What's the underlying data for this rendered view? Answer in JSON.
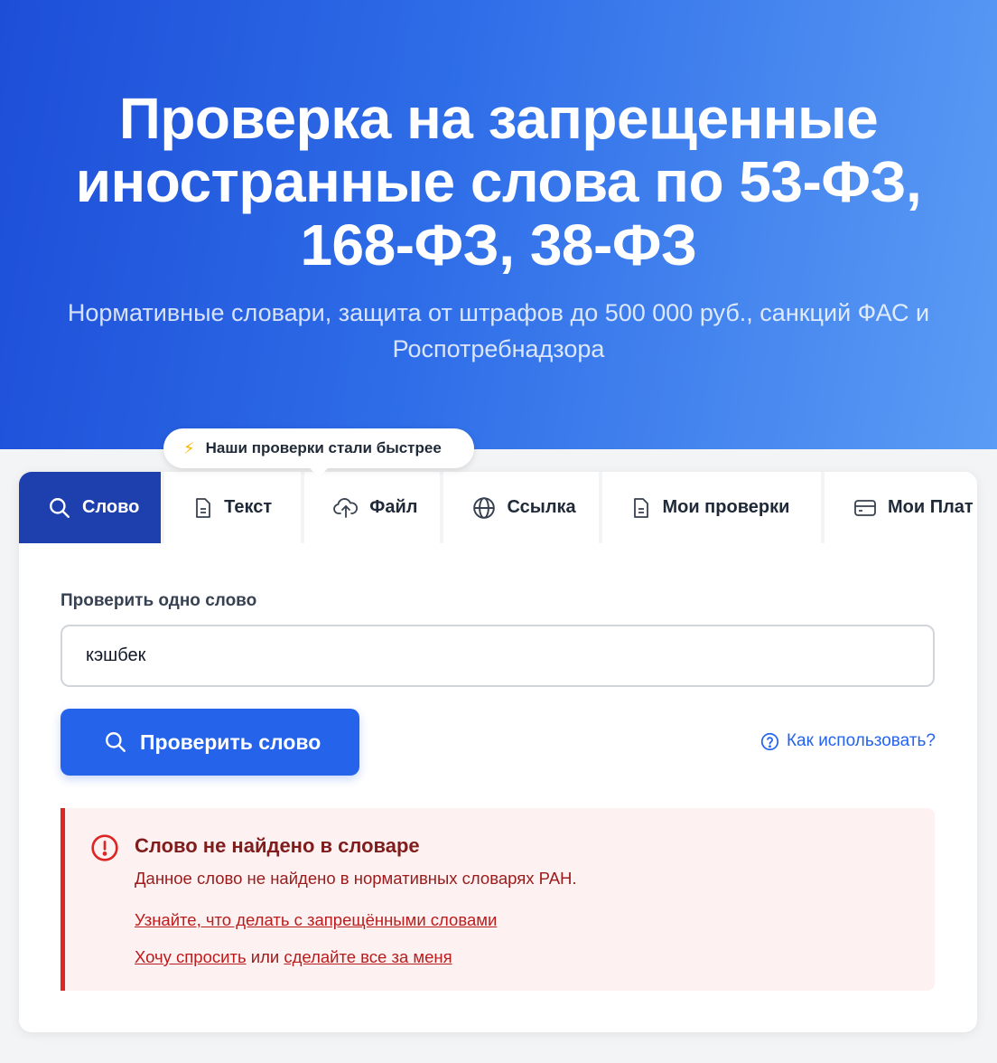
{
  "hero": {
    "title": "Проверка на запрещенные иностранные слова по 53-ФЗ, 168-ФЗ, 38-ФЗ",
    "subtitle": "Нормативные словари, защита от штрафов до 500 000 руб., санкций ФАС и Роспотребнадзора"
  },
  "tooltip": {
    "icon": "lightning-icon",
    "text": "Наши проверки стали быстрее"
  },
  "tabs": [
    {
      "label": "Слово",
      "icon": "search-icon",
      "active": true
    },
    {
      "label": "Текст",
      "icon": "document-icon",
      "active": false
    },
    {
      "label": "Файл",
      "icon": "cloud-upload-icon",
      "active": false
    },
    {
      "label": "Ссылка",
      "icon": "globe-icon",
      "active": false
    },
    {
      "label": "Мои проверки",
      "icon": "document-icon",
      "active": false
    },
    {
      "label": "Мои Плат",
      "icon": "credit-card-icon",
      "active": false
    }
  ],
  "form": {
    "label": "Проверить одно слово",
    "input_value": "кэшбек",
    "submit_label": "Проверить слово",
    "help_label": "Как использовать?"
  },
  "alert": {
    "title": "Слово не найдено в словаре",
    "text": "Данное слово не найдено в нормативных словарях РАН.",
    "link_learn": "Узнайте, что делать с запрещёнными словами",
    "link_ask": "Хочу спросить",
    "or_text": " или ",
    "link_do": "сделайте все за меня"
  },
  "colors": {
    "primary": "#2563eb",
    "tab_active": "#1e40af",
    "error": "#dc2626",
    "error_bg": "#fef1f1"
  }
}
